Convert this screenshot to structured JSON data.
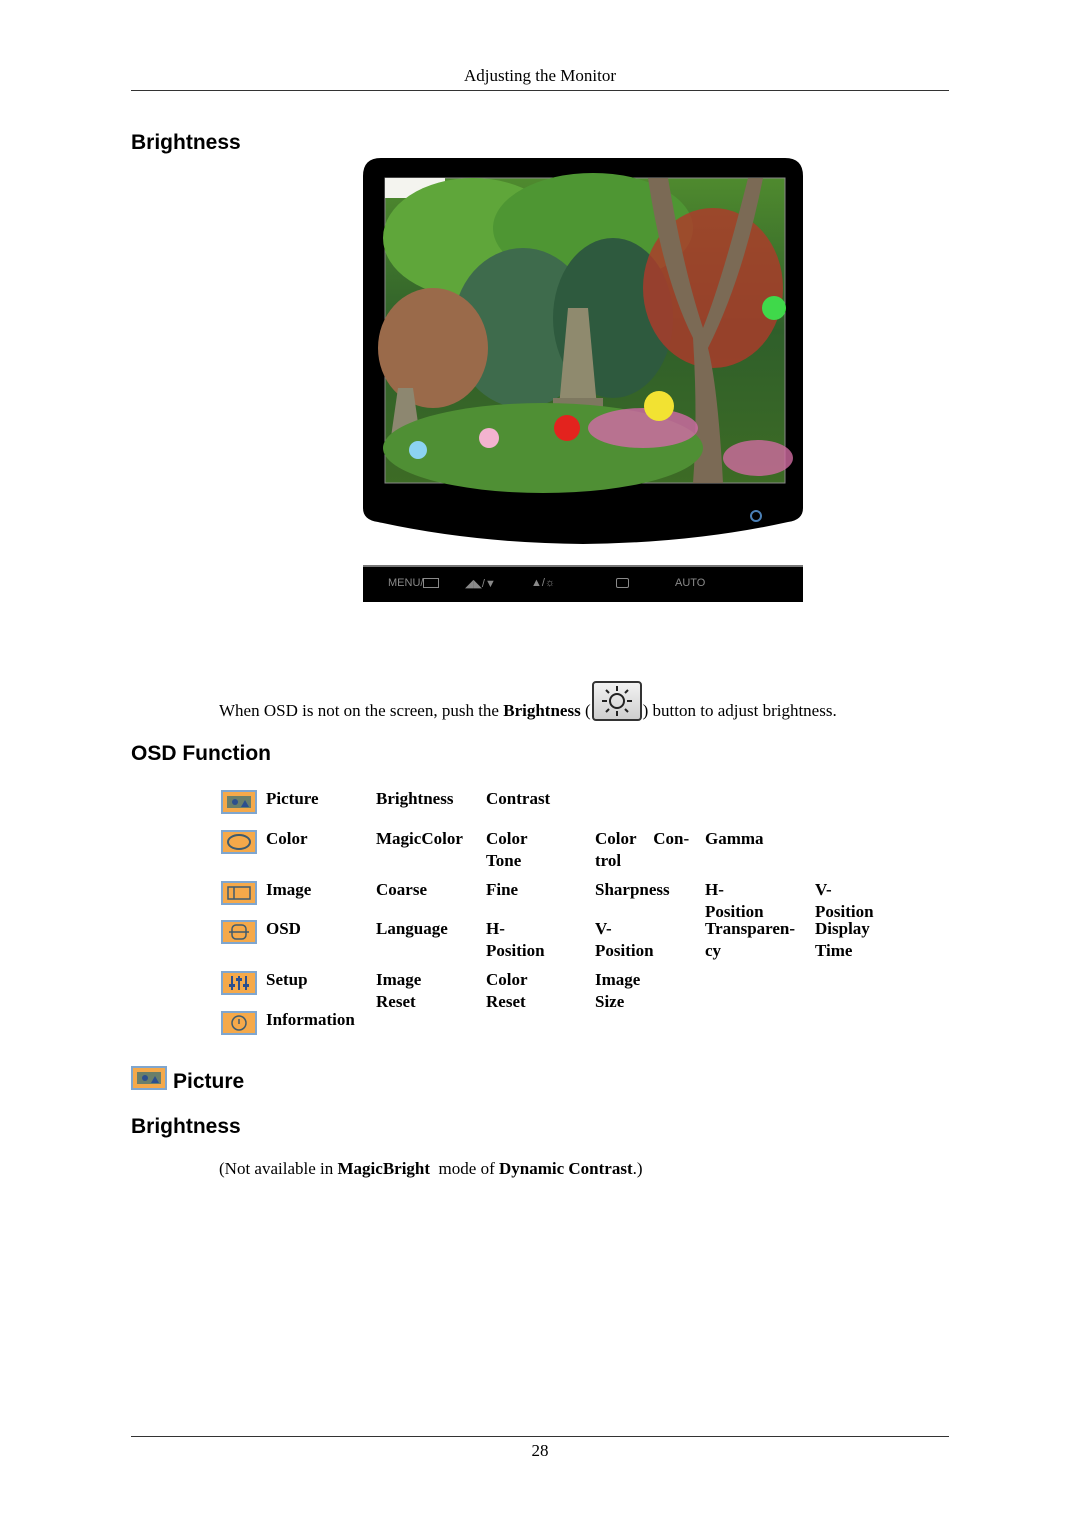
{
  "header": {
    "title": "Adjusting the Monitor"
  },
  "section1": {
    "heading": "Brightness"
  },
  "monitor_image": {
    "alt": "Monitor showing garden scene with pagoda and lanterns",
    "power_led_color": "#4a7fb5"
  },
  "control_bar": {
    "buttons": [
      {
        "label": "MENU/",
        "icon": "menu-grid-icon"
      },
      {
        "label": "/",
        "icon": "magicbright-down-icon"
      },
      {
        "label": "/",
        "icon": "up-brightness-icon"
      },
      {
        "label": "",
        "icon": "enter-icon"
      },
      {
        "label": "AUTO",
        "icon": ""
      }
    ]
  },
  "instruction": {
    "before": "When OSD is not on the screen, push the ",
    "bold": "Brightness",
    "open_paren": " (",
    "after": ") button to adjust brightness."
  },
  "osd": {
    "heading": "OSD Function",
    "rows": [
      {
        "icon": "picture-icon",
        "cells": [
          "Picture",
          "Brightness",
          "Contrast"
        ]
      },
      {
        "icon": "color-icon",
        "cells": [
          "Color",
          "MagicColor",
          "Color Tone",
          "Color    Con-\ntrol",
          "Gamma"
        ]
      },
      {
        "icon": "image-icon",
        "cells": [
          "Image",
          "Coarse",
          "Fine",
          "Sharpness",
          "H-Position",
          "V-Position"
        ]
      },
      {
        "icon": "osd-icon",
        "cells": [
          "OSD",
          "Language",
          "H-Position",
          "V-Position",
          "Transparen-\ncy",
          "Display Time"
        ]
      },
      {
        "icon": "setup-icon",
        "cells": [
          "Setup",
          "Image Reset",
          "Color Reset",
          "Image Size"
        ]
      },
      {
        "icon": "information-icon",
        "cells": [
          "Information"
        ]
      }
    ]
  },
  "picture_section": {
    "heading": "Picture",
    "icon": "picture-icon"
  },
  "brightness_section": {
    "heading": "Brightness",
    "note_open": "(Not available in ",
    "note_bold1": "MagicBright",
    "note_mid": "  mode of ",
    "note_bold2": "Dynamic Contrast",
    "note_close": ".)"
  },
  "footer": {
    "page_number": "28"
  }
}
